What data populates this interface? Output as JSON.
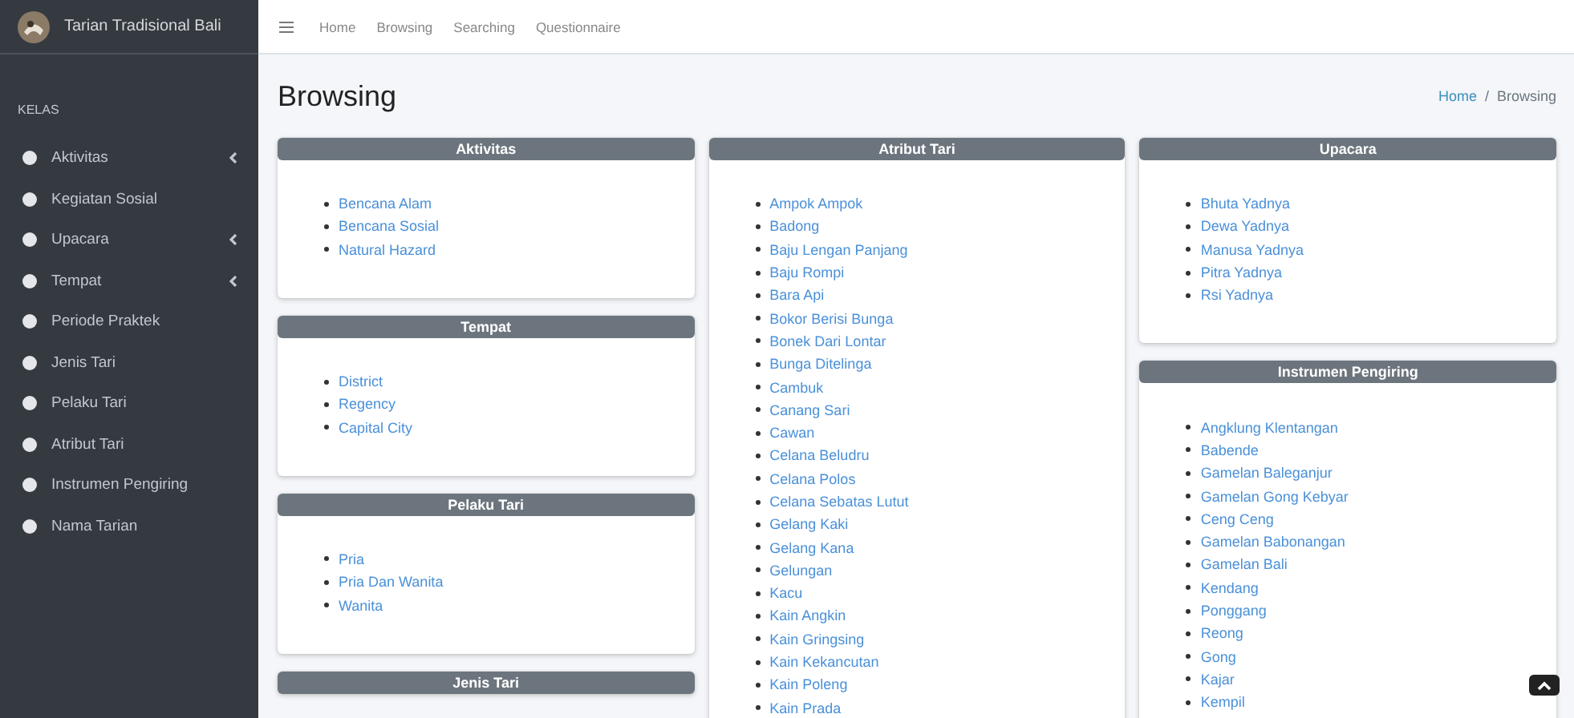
{
  "sidebar": {
    "brand": "Tarian Tradisional Bali",
    "section_label": "KELAS",
    "items": [
      {
        "label": "Aktivitas",
        "expandable": true
      },
      {
        "label": "Kegiatan Sosial",
        "expandable": false
      },
      {
        "label": "Upacara",
        "expandable": true
      },
      {
        "label": "Tempat",
        "expandable": true
      },
      {
        "label": "Periode Praktek",
        "expandable": false
      },
      {
        "label": "Jenis Tari",
        "expandable": false
      },
      {
        "label": "Pelaku Tari",
        "expandable": false
      },
      {
        "label": "Atribut Tari",
        "expandable": false
      },
      {
        "label": "Instrumen Pengiring",
        "expandable": false
      },
      {
        "label": "Nama Tarian",
        "expandable": false
      }
    ]
  },
  "topbar": {
    "nav": [
      "Home",
      "Browsing",
      "Searching",
      "Questionnaire"
    ]
  },
  "page": {
    "title": "Browsing",
    "breadcrumb": {
      "link": "Home",
      "separator": "/",
      "current": "Browsing"
    }
  },
  "columns": [
    [
      {
        "title": "Aktivitas",
        "items": [
          "Bencana Alam",
          "Bencana Sosial",
          "Natural Hazard"
        ]
      },
      {
        "title": "Tempat",
        "items": [
          "District",
          "Regency",
          "Capital City"
        ]
      },
      {
        "title": "Pelaku Tari",
        "items": [
          "Pria",
          "Pria Dan Wanita",
          "Wanita"
        ]
      },
      {
        "title": "Jenis Tari"
      }
    ],
    [
      {
        "title": "Atribut Tari",
        "items": [
          "Ampok Ampok",
          "Badong",
          "Baju Lengan Panjang",
          "Baju Rompi",
          "Bara Api",
          "Bokor Berisi Bunga",
          "Bonek Dari Lontar",
          "Bunga Ditelinga",
          "Cambuk",
          "Canang Sari",
          "Cawan",
          "Celana Beludru",
          "Celana Polos",
          "Celana Sebatas Lutut",
          "Gelang Kaki",
          "Gelang Kana",
          "Gelungan",
          "Kacu",
          "Kain Angkin",
          "Kain Gringsing",
          "Kain Kekancutan",
          "Kain Poleng",
          "Kain Prada"
        ]
      }
    ],
    [
      {
        "title": "Upacara",
        "items": [
          "Bhuta Yadnya",
          "Dewa Yadnya",
          "Manusa Yadnya",
          "Pitra Yadnya",
          "Rsi Yadnya"
        ]
      },
      {
        "title": "Instrumen Pengiring",
        "items": [
          "Angklung Klentangan",
          "Babende",
          "Gamelan Baleganjur",
          "Gamelan Gong Kebyar",
          "Ceng Ceng",
          "Gamelan Babonangan",
          "Gamelan Bali",
          "Kendang",
          "Ponggang",
          "Reong",
          "Gong",
          "Kajar",
          "Kempil"
        ]
      }
    ]
  ]
}
